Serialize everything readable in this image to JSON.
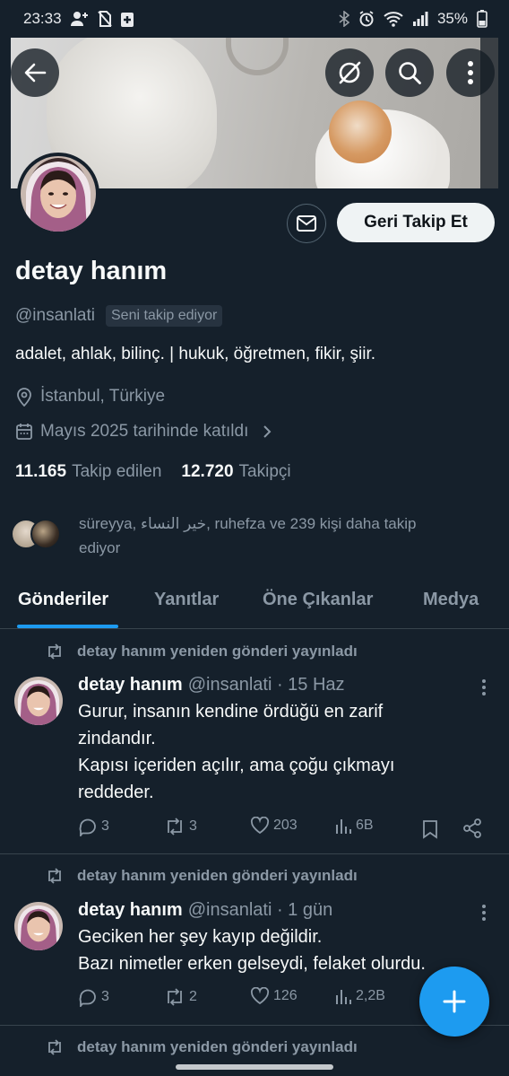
{
  "status_bar": {
    "time": "23:33",
    "battery": "35%"
  },
  "profile": {
    "name": "detay hanım",
    "handle": "@insanlati",
    "follows_you_badge": "Seni takip ediyor",
    "bio": "adalet, ahlak, bilinç. | hukuk, öğretmen, fikir, şiir.",
    "location": "İstanbul, Türkiye",
    "joined": "Mayıs 2025 tarihinde katıldı",
    "following_count": "11.165",
    "following_label": "Takip edilen",
    "followers_count": "12.720",
    "followers_label": "Takipçi",
    "followed_by_line1": "süreyya, خير النساء, ruhefza ve 239 kişi daha takip",
    "followed_by_line2": "ediyor",
    "follow_back_label": "Geri Takip Et"
  },
  "tabs": [
    {
      "label": "Gönderiler",
      "active": true
    },
    {
      "label": "Yanıtlar",
      "active": false
    },
    {
      "label": "Öne Çıkanlar",
      "active": false
    },
    {
      "label": "Medya",
      "active": false
    }
  ],
  "tweets": [
    {
      "repost_text": "detay hanım yeniden gönderi yayınladı",
      "name": "detay hanım",
      "meta": "@insanlati · 15 Haz",
      "body": [
        "Gurur, insanın kendine ördüğü en zarif",
        "zindandır.",
        "Kapısı içeriden açılır, ama çoğu çıkmayı",
        "reddeder."
      ],
      "replies": "3",
      "reposts": "3",
      "likes": "203",
      "views": "6B"
    },
    {
      "repost_text": "detay hanım yeniden gönderi yayınladı",
      "name": "detay hanım",
      "meta": "@insanlati · 1 gün",
      "body": [
        "Geciken her şey kayıp değildir.",
        "Bazı nimetler erken gelseydi, felaket olurdu."
      ],
      "replies": "3",
      "reposts": "2",
      "likes": "126",
      "views": "2,2B"
    },
    {
      "repost_text": "detay hanım yeniden gönderi yayınladı"
    }
  ],
  "colors": {
    "background": "#15202b",
    "accent": "#1d9bf0",
    "secondary_text": "#8b98a5"
  }
}
